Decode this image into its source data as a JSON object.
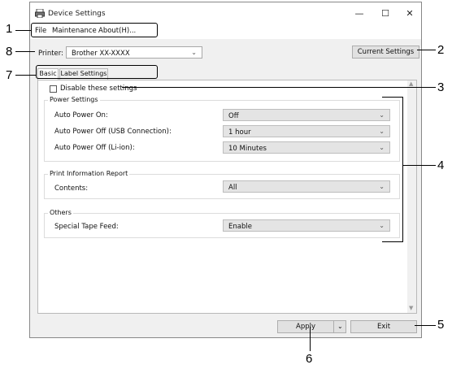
{
  "window": {
    "title": "Device Settings",
    "controls": {
      "minimize": "—",
      "maximize": "☐",
      "close": "✕"
    }
  },
  "menu": [
    "File",
    "Maintenance",
    "About(H)..."
  ],
  "printer": {
    "label": "Printer:",
    "value": "Brother  XX-XXXX"
  },
  "current_settings_button": "Current Settings",
  "tabs": [
    "Basic",
    "Label Settings"
  ],
  "active_tab": "Basic",
  "disable_checkbox": {
    "label": "Disable these settings",
    "checked": false
  },
  "groups": {
    "power": {
      "title": "Power Settings",
      "rows": [
        {
          "label": "Auto Power On:",
          "value": "Off"
        },
        {
          "label": "Auto Power Off (USB Connection):",
          "value": "1 hour"
        },
        {
          "label": "Auto Power Off (Li-ion):",
          "value": "10 Minutes"
        }
      ]
    },
    "print_info": {
      "title": "Print Information Report",
      "rows": [
        {
          "label": "Contents:",
          "value": "All"
        }
      ]
    },
    "others": {
      "title": "Others",
      "rows": [
        {
          "label": "Special Tape Feed:",
          "value": "Enable"
        }
      ]
    }
  },
  "buttons": {
    "apply": "Apply",
    "exit": "Exit"
  },
  "callouts": [
    "1",
    "2",
    "3",
    "4",
    "5",
    "6",
    "7",
    "8"
  ]
}
